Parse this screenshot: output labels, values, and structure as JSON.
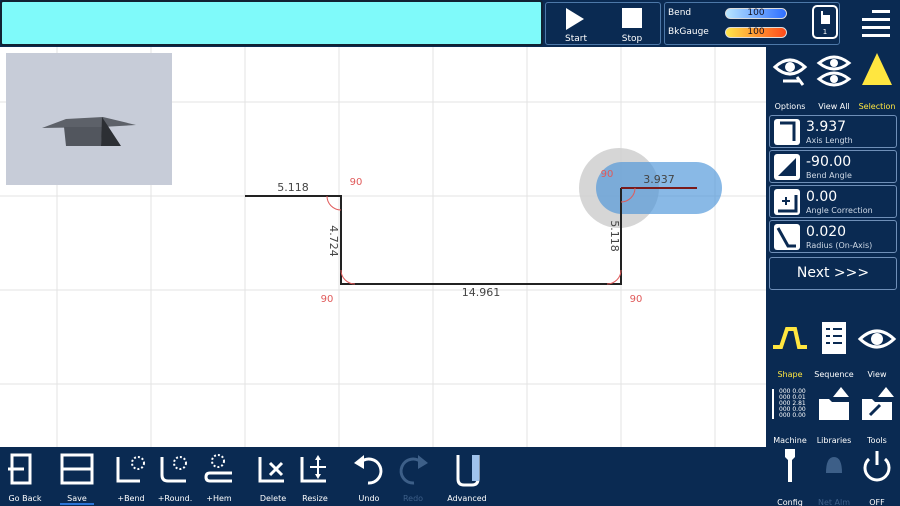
{
  "run": {
    "start_label": "Start",
    "stop_label": "Stop"
  },
  "gauges": [
    {
      "label": "Bend",
      "value": "100",
      "color": "#2f6fff"
    },
    {
      "label": "BkGauge",
      "value": "100",
      "color": "#ff4a1a"
    }
  ],
  "hand_counter": "1",
  "drawing": {
    "dims": [
      "5.118",
      "4.724",
      "14.961",
      "5.118",
      "3.937"
    ],
    "angles": [
      "90",
      "90",
      "90",
      "90"
    ]
  },
  "view_tools": [
    {
      "label": "Options",
      "icon": "eye-wrench-icon"
    },
    {
      "label": "View All",
      "icon": "eyes-icon"
    },
    {
      "label": "Selection",
      "icon": "arrow-pointer-icon"
    }
  ],
  "fields": [
    {
      "value": "3.937",
      "sub": "Axis Length",
      "icon": "axis-length-icon"
    },
    {
      "value": "-90.00",
      "sub": "Bend Angle",
      "icon": "bend-angle-icon"
    },
    {
      "value": "0.00",
      "sub": "Angle Correction",
      "icon": "angle-correction-icon"
    },
    {
      "value": "0.020",
      "sub": "Radius (On-Axis)",
      "icon": "radius-icon"
    }
  ],
  "next_label": "Next >>>",
  "mode_tools": [
    {
      "label": "Shape",
      "icon": "shape-icon"
    },
    {
      "label": "Sequence",
      "icon": "sequence-icon"
    },
    {
      "label": "View",
      "icon": "eye-icon"
    },
    {
      "label": "Machine",
      "icon": "machine-icon"
    },
    {
      "label": "Libraries",
      "icon": "folder-up-icon"
    },
    {
      "label": "Tools",
      "icon": "folder-wrench-icon"
    },
    {
      "label": "Config",
      "icon": "wrench-icon"
    },
    {
      "label": "Net Alm",
      "icon": "bell-icon"
    },
    {
      "label": "OFF",
      "icon": "power-icon"
    }
  ],
  "machine_readout": [
    "000 0.00",
    "000 0.01",
    "000 2.81",
    "000 0.00",
    "000 0.00"
  ],
  "bottom": [
    {
      "label": "Go Back",
      "icon": "exit-icon"
    },
    {
      "label": "Save",
      "icon": "save-icon"
    },
    {
      "label": "+Bend",
      "icon": "add-bend-icon"
    },
    {
      "label": "+Round.",
      "icon": "add-round-icon"
    },
    {
      "label": "+Hem",
      "icon": "add-hem-icon"
    },
    {
      "label": "Delete",
      "icon": "delete-icon"
    },
    {
      "label": "Resize",
      "icon": "resize-icon"
    },
    {
      "label": "Undo",
      "icon": "undo-icon"
    },
    {
      "label": "Redo",
      "icon": "redo-icon"
    },
    {
      "label": "Advanced",
      "icon": "advanced-icon"
    }
  ],
  "colors": {
    "accent": "#ffe640",
    "angle": "#e05a5a",
    "selection": "#4a93d8",
    "panel": "#0a2a52"
  }
}
